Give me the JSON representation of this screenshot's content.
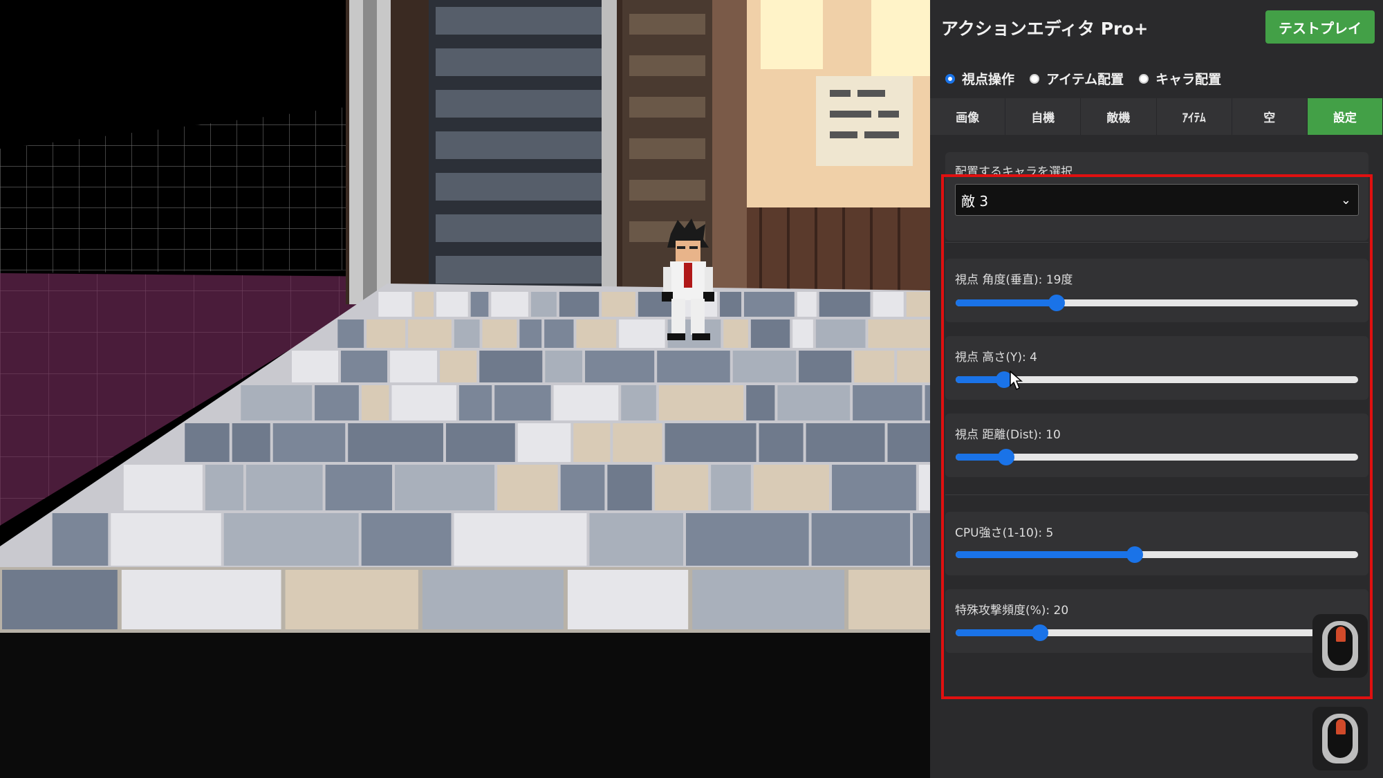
{
  "app": {
    "title": "アクションエディタ Pro+",
    "test_play_label": "テストプレイ"
  },
  "modes": [
    {
      "label": "視点操作",
      "checked": true
    },
    {
      "label": "アイテム配置",
      "checked": false
    },
    {
      "label": "キャラ配置",
      "checked": false
    }
  ],
  "tabs": [
    {
      "label": "画像",
      "active": false
    },
    {
      "label": "自機",
      "active": false
    },
    {
      "label": "敵機",
      "active": false
    },
    {
      "label": "ｱｲﾃﾑ",
      "active": false
    },
    {
      "label": "空",
      "active": false
    },
    {
      "label": "設定",
      "active": true
    }
  ],
  "char_select": {
    "label": "配置するキャラを選択",
    "value": "敵 3"
  },
  "sliders": [
    {
      "label": "視点 角度(垂直): 19度",
      "fraction": 0.25
    },
    {
      "label": "視点 高さ(Y): 4",
      "fraction": 0.12
    },
    {
      "label": "視点 距離(Dist): 10",
      "fraction": 0.125
    },
    {
      "label": "CPU強さ(1-10): 5",
      "fraction": 0.445
    },
    {
      "label": "特殊攻撃頻度(%): 20",
      "fraction": 0.21
    }
  ],
  "colors": {
    "accent": "#1a73e8",
    "active_tab": "#43a047",
    "highlight": "#e01010"
  },
  "icons": [
    "mouse-left-click-icon",
    "mouse-left-click-icon",
    "chevron-down-icon",
    "cursor-arrow-icon"
  ]
}
